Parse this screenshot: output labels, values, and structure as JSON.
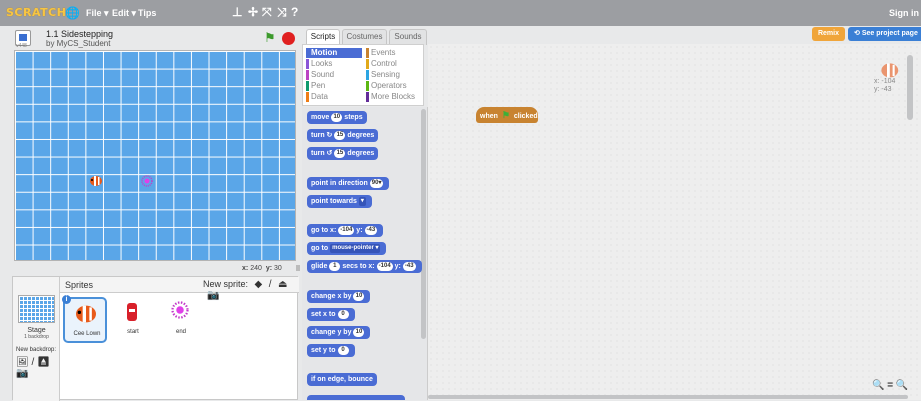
{
  "topbar": {
    "logo": "SCRATCH",
    "globe_icon": "globe-icon",
    "menus": [
      "File ▾",
      "Edit ▾",
      "Tips"
    ],
    "tools": [
      "duplicate-stamp-icon",
      "cut-icon",
      "grow-icon",
      "shrink-icon",
      "help-icon"
    ],
    "sign_in": "Sign in"
  },
  "stage_header": {
    "version": "v448",
    "title": "1.1 Sidestepping",
    "author": "by MyCS_Student"
  },
  "stage": {
    "x_label": "x:",
    "x_value": "240",
    "y_label": "y:",
    "y_value": "30"
  },
  "sprites_pane": {
    "label": "Sprites",
    "new_sprite": "New sprite:",
    "stage_name": "Stage",
    "stage_backdrops": "1 backdrop",
    "new_backdrop": "New backdrop:",
    "sprites": [
      {
        "name": "Cee Lown",
        "selected": true
      },
      {
        "name": "start",
        "selected": false
      },
      {
        "name": "end",
        "selected": false
      }
    ]
  },
  "tabs": [
    "Scripts",
    "Costumes",
    "Sounds"
  ],
  "categories": [
    {
      "label": "Motion",
      "color": "#4a6cd4"
    },
    {
      "label": "Events",
      "color": "#c88330"
    },
    {
      "label": "Looks",
      "color": "#8a55d7"
    },
    {
      "label": "Control",
      "color": "#e1a91a"
    },
    {
      "label": "Sound",
      "color": "#bb42c3"
    },
    {
      "label": "Sensing",
      "color": "#2ca5e2"
    },
    {
      "label": "Pen",
      "color": "#0e9a6c"
    },
    {
      "label": "Operators",
      "color": "#5cb712"
    },
    {
      "label": "Data",
      "color": "#ee7d16"
    },
    {
      "label": "More Blocks",
      "color": "#632d99"
    }
  ],
  "blocks": {
    "move_a": "move",
    "move_v": "10",
    "move_b": "steps",
    "turn_r_a": "turn ↻",
    "turn_r_v": "15",
    "turn_r_b": "degrees",
    "turn_l_a": "turn ↺",
    "turn_l_v": "15",
    "turn_l_b": "degrees",
    "pdir_a": "point in direction",
    "pdir_v": "90▾",
    "ptow": "point towards",
    "ptow_v": "▾",
    "goto_a": "go to x:",
    "goto_x": "-104",
    "goto_b": "y:",
    "goto_y": "-43",
    "goto2_a": "go to",
    "goto2_v": "mouse-pointer ▾",
    "glide_a": "glide",
    "glide_v": "1",
    "glide_b": "secs to x:",
    "glide_x": "-104",
    "glide_c": "y:",
    "glide_y": "-43",
    "cx_a": "change x by",
    "cx_v": "10",
    "sx_a": "set x to",
    "sx_v": "0",
    "cy_a": "change y by",
    "cy_v": "10",
    "sy_a": "set y to",
    "sy_v": "0",
    "bounce": "if on edge, bounce"
  },
  "scripts_area": {
    "hat_when": "when",
    "hat_clicked": "clicked",
    "sprite_x": "x: -104",
    "sprite_y": "y: -43",
    "remix": "Remix",
    "see_project": "See project page",
    "zoom": "🔍 = 🔍"
  }
}
